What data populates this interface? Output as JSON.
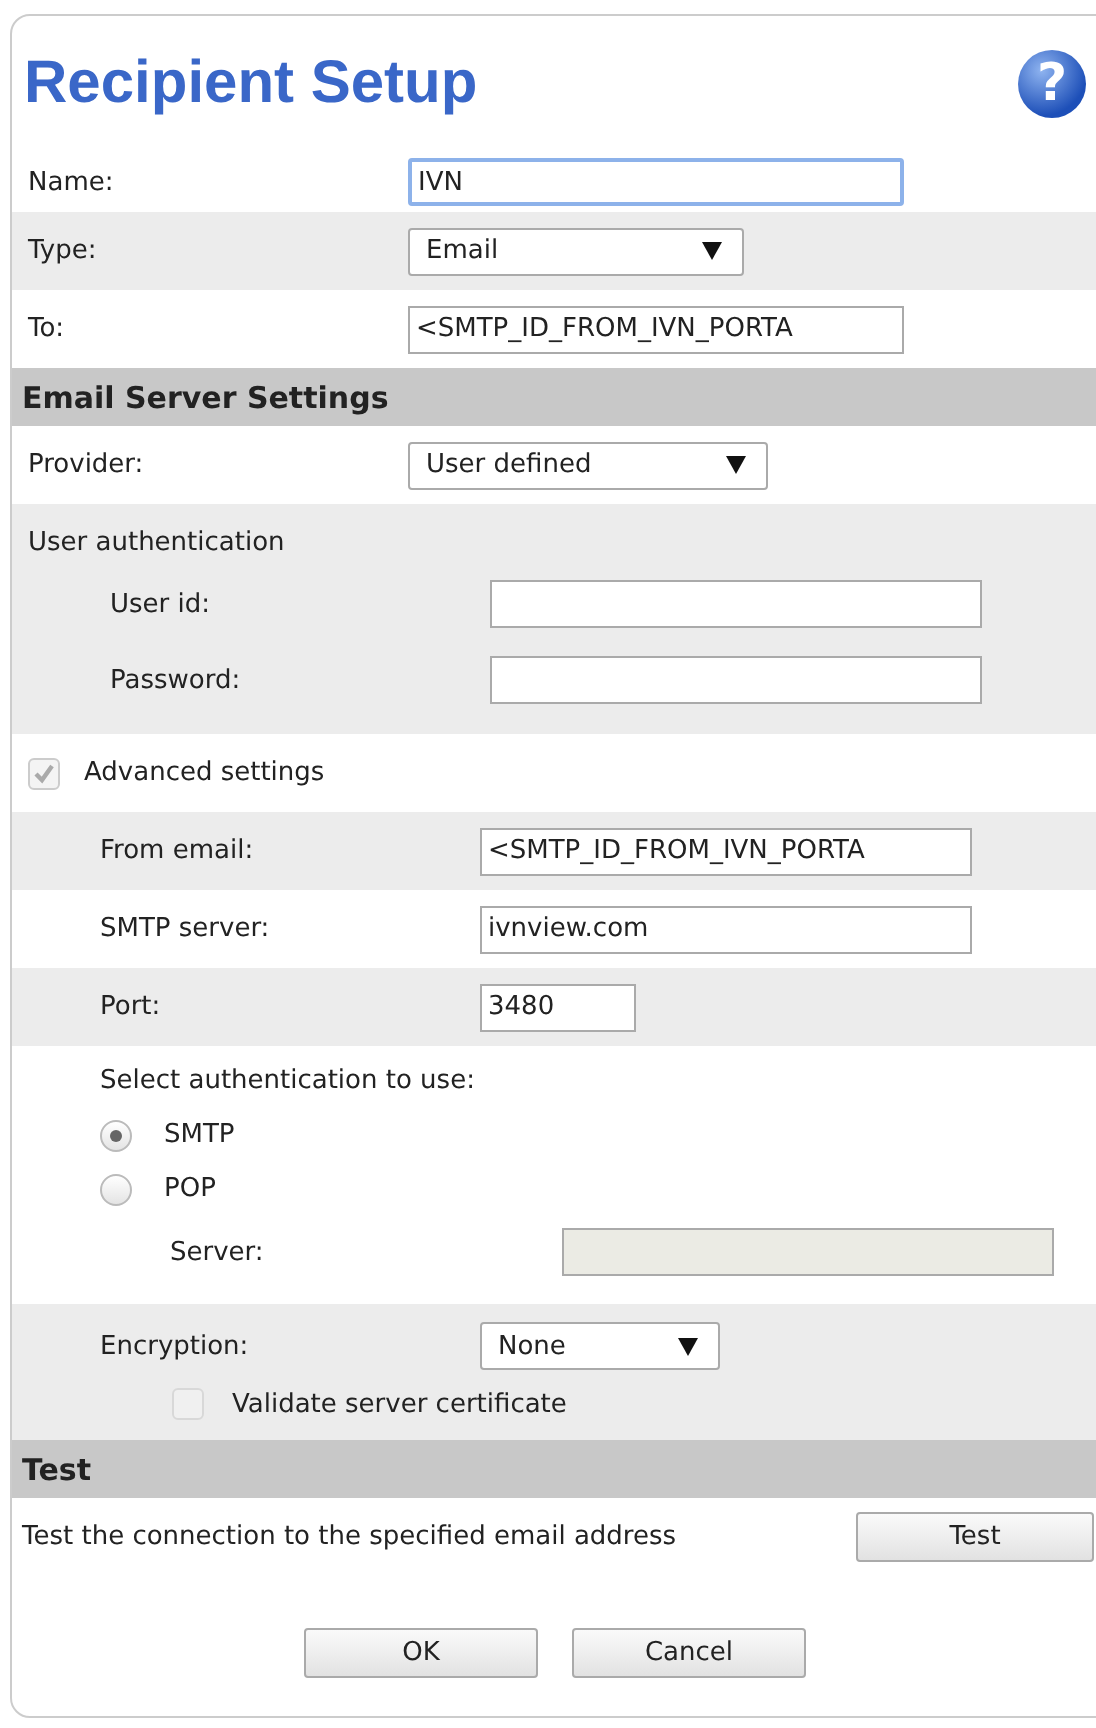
{
  "title": "Recipient Setup",
  "help": "?",
  "general": [
    {
      "kind": "text",
      "label": "Name:",
      "value": "IVN",
      "focused": true
    },
    {
      "kind": "select",
      "label": "Type:",
      "value": "Email",
      "focused": false
    },
    {
      "kind": "text",
      "label": "To:",
      "value": "<SMTP_ID_FROM_IVN_PORTA",
      "focused": false
    }
  ],
  "email_server": {
    "heading": "Email Server Settings",
    "provider": {
      "label": "Provider:",
      "value": "User defined"
    },
    "user_auth": {
      "heading": "User authentication",
      "fields": [
        {
          "label": "User id:"
        },
        {
          "label": "Password:"
        }
      ]
    },
    "advanced": {
      "label": "Advanced settings",
      "checked": true,
      "disabled": true
    },
    "advanced_fields": [
      {
        "kind": "text",
        "label": "From email:",
        "value": "<SMTP_ID_FROM_IVN_PORTA"
      },
      {
        "kind": "text",
        "label": "SMTP server:",
        "value": "ivnview.com"
      },
      {
        "kind": "short",
        "label": "Port:",
        "value": "3480"
      }
    ],
    "auth": {
      "heading": "Select authentication to use:",
      "options": [
        {
          "label": "SMTP",
          "selected": true
        },
        {
          "label": "POP",
          "selected": false
        }
      ],
      "server": {
        "label": "Server:",
        "disabled": true
      }
    },
    "encryption": {
      "label": "Encryption:",
      "value": "None",
      "validate": {
        "label": "Validate server certificate",
        "checked": false,
        "disabled": true
      }
    }
  },
  "test": {
    "heading": "Test",
    "text": "Test the connection to the specified email address",
    "button": "Test"
  },
  "buttons": [
    "OK",
    "Cancel"
  ]
}
